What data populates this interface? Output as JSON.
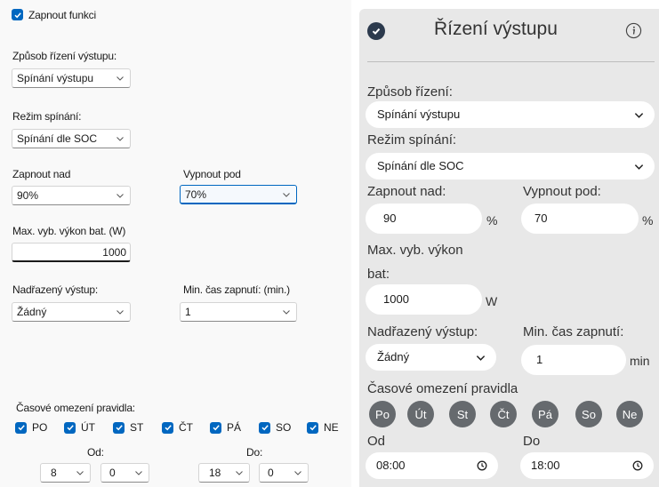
{
  "left": {
    "enable_label": "Zapnout funkci",
    "output_control_label": "Způsob řízení výstupu:",
    "output_control_value": "Spínání výstupu",
    "switch_mode_label": "Režim spínání:",
    "switch_mode_value": "Spínání dle SOC",
    "on_above_label": "Zapnout nad",
    "on_above_value": "90%",
    "off_below_label": "Vypnout pod",
    "off_below_value": "70%",
    "max_power_label": "Max. vyb. výkon bat. (W)",
    "max_power_value": "1000",
    "parent_output_label": "Nadřazený výstup:",
    "parent_output_value": "Žádný",
    "min_on_time_label": "Min. čas zapnutí: (min.)",
    "min_on_time_value": "1",
    "time_limit_label": "Časové omezení pravidla:",
    "days": [
      "PO",
      "ÚT",
      "ST",
      "ČT",
      "PÁ",
      "SO",
      "NE"
    ],
    "from_label": "Od:",
    "from_hour": "8",
    "from_min": "0",
    "to_label": "Do:",
    "to_hour": "18",
    "to_min": "0"
  },
  "right": {
    "title": "Řízení výstupu",
    "info_icon": "info-icon",
    "output_control_label": "Způsob řízení:",
    "output_control_value": "Spínání výstupu",
    "switch_mode_label": "Režim spínání:",
    "switch_mode_value": "Spínání dle SOC",
    "on_above_label": "Zapnout nad:",
    "on_above_value": "90",
    "on_above_unit": "%",
    "off_below_label": "Vypnout pod:",
    "off_below_value": "70",
    "off_below_unit": "%",
    "max_power_label_1": "Max. vyb. výkon",
    "max_power_label_2": "bat:",
    "max_power_value": "1000",
    "max_power_unit": "W",
    "parent_output_label": "Nadřazený výstup:",
    "parent_output_value": "Žádný",
    "min_on_time_label": "Min. čas zapnutí:",
    "min_on_time_value": "1",
    "min_on_time_unit": "min",
    "time_limit_label": "Časové omezení pravidla",
    "days": [
      "Po",
      "Út",
      "St",
      "Čt",
      "Pá",
      "So",
      "Ne"
    ],
    "from_label": "Od",
    "from_value": "08:00",
    "to_label": "Do",
    "to_value": "18:00"
  },
  "colors": {
    "accent_blue": "#0067c0",
    "panel_gray": "#e8e8e8",
    "day_button": "#666a6e"
  }
}
